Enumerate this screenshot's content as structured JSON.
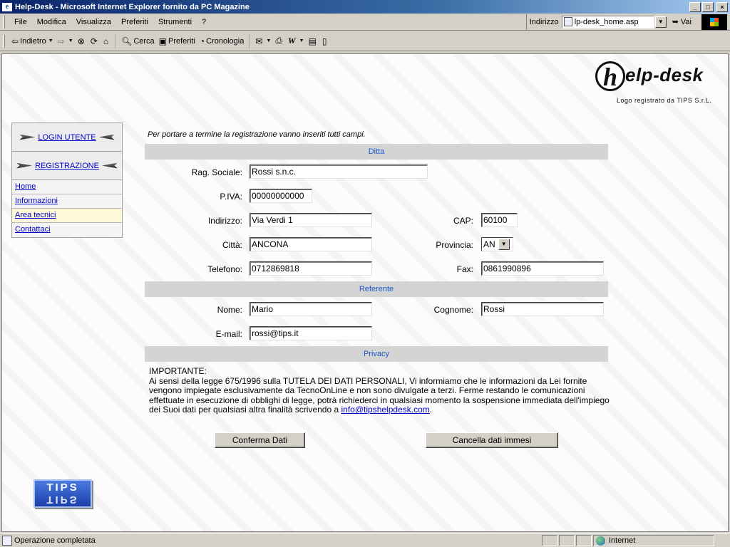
{
  "window": {
    "title": "Help-Desk - Microsoft Internet Explorer fornito da PC Magazine",
    "min_label": "_",
    "max_label": "□",
    "close_label": "×"
  },
  "menu": {
    "items": [
      "File",
      "Modifica",
      "Visualizza",
      "Preferiti",
      "Strumenti",
      "?"
    ],
    "address_label": "Indirizzo",
    "address_value": "lp-desk_home.asp",
    "go_label": "Vai"
  },
  "toolbar": {
    "back": "Indietro",
    "search": "Cerca",
    "favorites": "Preferiti",
    "history": "Cronologia"
  },
  "logo": {
    "letter": "h",
    "text": "elp-desk",
    "subtitle": "Logo registrato da TIPS S.r.L."
  },
  "nav": {
    "login": "LOGIN UTENTE",
    "register": "REGISTRAZIONE",
    "links": [
      "Home",
      "Informazioni",
      "Area tecnici",
      "Contattaci"
    ]
  },
  "tips_logo": "TIPS",
  "form": {
    "intro": "Per portare a termine la registrazione vanno inseriti tutti campi.",
    "sections": {
      "company": "Ditta",
      "contact": "Referente",
      "privacy": "Privacy"
    },
    "labels": {
      "rag_sociale": "Rag. Sociale:",
      "piva": "P.IVA:",
      "indirizzo": "Indirizzo:",
      "cap": "CAP:",
      "citta": "Città:",
      "provincia": "Provincia:",
      "telefono": "Telefono:",
      "fax": "Fax:",
      "nome": "Nome:",
      "cognome": "Cognome:",
      "email": "E-mail:"
    },
    "values": {
      "rag_sociale": "Rossi s.n.c.",
      "piva": "00000000000",
      "indirizzo": "Via Verdi 1",
      "cap": "60100",
      "citta": "ANCONA",
      "provincia": "AN",
      "telefono": "0712869818",
      "fax": "0861990896",
      "nome": "Mario",
      "cognome": "Rossi",
      "email": "rossi@tips.it"
    },
    "privacy_heading": "IMPORTANTE:",
    "privacy_text": "Ai sensi della legge 675/1996 sulla TUTELA DEI DATI PERSONALI, Vi informiamo che le informazioni da Lei fornite vengono impiegate esclusivamente da TecnoOnLine e non sono divulgate a terzi. Ferme restando le comunicazioni effettuate in esecuzione di obblighi di legge, potrà richiederci in qualsiasi momento la sospensione immediata dell'impiego dei Suoi dati per qualsiasi altra finalità scrivendo a",
    "privacy_email": "info@tipshelpdesk.com",
    "privacy_end": ".",
    "confirm_button": "Conferma Dati",
    "cancel_button": "Cancella dati immesi"
  },
  "status": {
    "text": "Operazione completata",
    "zone": "Internet"
  }
}
